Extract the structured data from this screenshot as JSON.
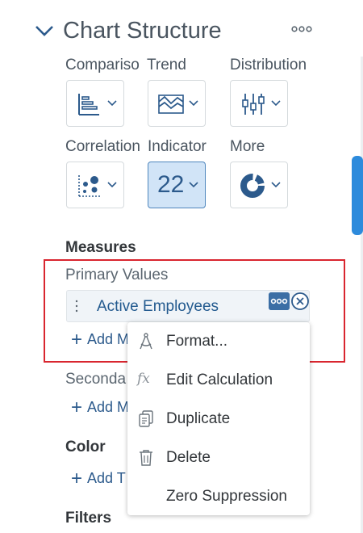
{
  "panel": {
    "title": "Chart Structure",
    "collapse_icon": "chevron-down-icon",
    "more_icon": "more-horizontal-icon"
  },
  "chart_types": [
    {
      "label": "Compariso",
      "icon": "bar-chart-icon",
      "selected": false
    },
    {
      "label": "Trend",
      "icon": "area-chart-icon",
      "selected": false
    },
    {
      "label": "Distribution",
      "icon": "box-plot-icon",
      "selected": false
    },
    {
      "label": "Correlation",
      "icon": "scatter-chart-icon",
      "selected": false
    },
    {
      "label": "Indicator",
      "icon": "numeric-indicator-icon",
      "glyph": "22",
      "selected": true
    },
    {
      "label": "More",
      "icon": "donut-chart-icon",
      "selected": false
    }
  ],
  "measures": {
    "title": "Measures",
    "primary_label": "Primary Values",
    "primary_item": "Active Employees",
    "add_label_primary": "Add M",
    "secondary_label": "Seconda",
    "add_label_secondary": "Add M"
  },
  "color": {
    "title": "Color",
    "add_label": "Add T"
  },
  "filters": {
    "title": "Filters"
  },
  "context_menu": {
    "items": [
      {
        "label": "Format...",
        "icon": "compass-icon"
      },
      {
        "label": "Edit Calculation",
        "icon": "fx-icon",
        "glyph": "fx"
      },
      {
        "label": "Duplicate",
        "icon": "duplicate-icon"
      },
      {
        "label": "Delete",
        "icon": "trash-icon"
      },
      {
        "label": "Zero Suppression",
        "icon": ""
      }
    ]
  },
  "colors": {
    "accent": "#2d8bdc",
    "selected_bg": "#d1e4f7",
    "link": "#2c5a8c",
    "highlight": "#d9262f"
  }
}
